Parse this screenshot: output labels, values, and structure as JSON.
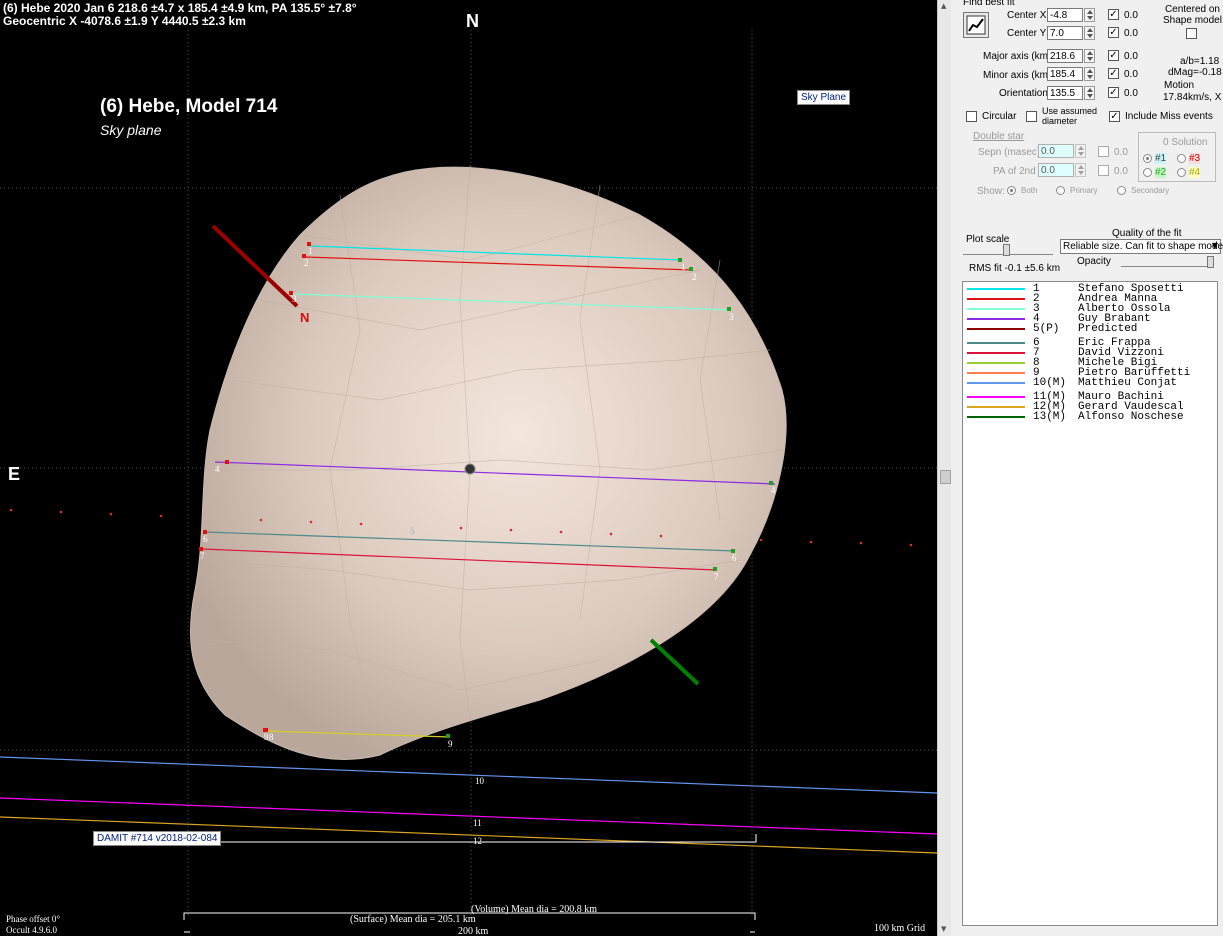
{
  "plot": {
    "header_line1": "(6) Hebe  2020 Jan 6   218.6 ±4.7 x 185.4 ±4.9 km, PA 135.5° ±7.8°",
    "header_line2": "Geocentric  X  -4078.6 ±1.9  Y 4440.5 ±2.3 km",
    "title": "(6)  Hebe,   Model 714",
    "subtitle": "Sky plane",
    "north_label": "N",
    "east_label": "E",
    "pole_label": "N",
    "sky_plane_tag": "Sky Plane",
    "damit_tag": "DAMIT #714 v2018-02-084",
    "volume_dia": "(Volume) Mean dia = 200.8 km",
    "surface_dia": "(Surface) Mean dia = 205.1 km",
    "scale_label": "200 km",
    "grid_label": "100 km Grid",
    "phase_offset": "Phase offset 0°",
    "version": "Occult 4.9.6.0",
    "chord_labels": [
      "1",
      "2",
      "3",
      "4",
      "5",
      "6",
      "7",
      "8",
      "9",
      "10",
      "11",
      "12"
    ],
    "colors": {
      "background": "#000000",
      "body": "#e9dcd2",
      "chord_1": "#00e5e5",
      "chord_2": "#e01010",
      "chord_3": "#7fffd4",
      "chord_4": "#8a2be2",
      "chord_pred": "#8b0000",
      "chord_6": "#4f8a8a",
      "chord_7": "#dc143c",
      "chord_8": "#9acd32",
      "chord_9": "#ff7f50",
      "chord_10": "#6495ed",
      "chord_11": "#ff00ff",
      "chord_12": "#daa520",
      "chord_13": "#006400"
    }
  },
  "panel": {
    "find_best_fit": "Find best fit",
    "center_x_label": "Center X",
    "center_x_value": "-4.8",
    "center_y_label": "Center Y",
    "center_y_value": "7.0",
    "major_label": "Major axis (km)",
    "major_value": "218.6",
    "minor_label": "Minor axis (km)",
    "minor_value": "185.4",
    "orient_label": "Orientation",
    "orient_value": "135.5",
    "fit_delta": "0.0",
    "centered_on": "Centered on\nShape model",
    "ab_ratio": "a/b=1.18",
    "dmag": "dMag=-0.18",
    "motion_label": "Motion",
    "motion_value": "17.84km/s, X",
    "circular_label": "Circular",
    "assumed_label": "Use assumed diameter",
    "miss_label": "Include Miss events",
    "double_star": "Double star",
    "sepn_label": "Sepn (masec)",
    "sepn_value": "0.0",
    "pa2_label": "PA of 2nd",
    "pa2_value": "0.0",
    "show_label": "Show:",
    "show_both": "Both",
    "show_primary": "Primary",
    "show_secondary": "Secondary",
    "solution_title": "0 Solution",
    "sol1": "#1",
    "sol2": "#2",
    "sol3": "#3",
    "sol4": "#4",
    "plot_scale": "Plot scale",
    "rms_fit": "RMS fit -0.1 ±5.6 km",
    "quality_title": "Quality of the fit",
    "quality_value": "Reliable size. Can fit to shape mode",
    "opacity_label": "Opacity"
  },
  "observers": [
    {
      "num": "1",
      "name": "Stefano Sposetti",
      "color": "#00e5e5"
    },
    {
      "num": "2",
      "name": "Andrea Manna",
      "color": "#e01010"
    },
    {
      "num": "3",
      "name": "Alberto Ossola",
      "color": "#7fffd4"
    },
    {
      "num": "4",
      "name": "Guy Brabant",
      "color": "#8a2be2"
    },
    {
      "num": "5(P)",
      "name": "Predicted",
      "color": "#8b0000"
    },
    {
      "num": "6",
      "name": "Eric Frappa",
      "color": "#4f8a8a"
    },
    {
      "num": "7",
      "name": "David Vizzoni",
      "color": "#dc143c"
    },
    {
      "num": "8",
      "name": "Michele Bigi",
      "color": "#9acd32"
    },
    {
      "num": "9",
      "name": "Pietro Baruffetti",
      "color": "#ff7f50"
    },
    {
      "num": "10(M)",
      "name": "Matthieu Conjat",
      "color": "#6495ed"
    },
    {
      "num": "11(M)",
      "name": "Mauro Bachini",
      "color": "#ff00ff"
    },
    {
      "num": "12(M)",
      "name": "Gerard Vaudescal",
      "color": "#daa520"
    },
    {
      "num": "13(M)",
      "name": "Alfonso Noschese",
      "color": "#006400"
    }
  ]
}
